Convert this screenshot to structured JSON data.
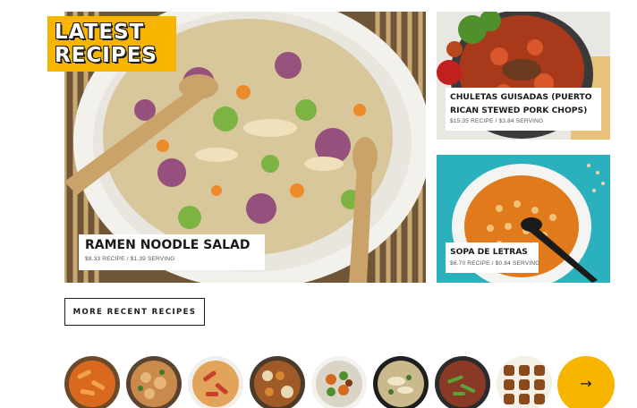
{
  "section": {
    "badge_line1": "LATEST",
    "badge_line2": "RECIPES",
    "badge_color": "#f7b500"
  },
  "featured": {
    "title": "RAMEN NOODLE SALAD",
    "cost": "$8.33 RECIPE / $1.39 SERVING"
  },
  "side_recipes": [
    {
      "title_line1": "CHULETAS GUISADAS (PUERTO",
      "title_line2": "RICAN STEWED PORK CHOPS)",
      "cost": "$15.35 RECIPE / $3.84 SERVING"
    },
    {
      "title": "SOPA DE LETRAS",
      "cost": "$6.70 RECIPE / $0.84 SERVING"
    }
  ],
  "more_button": {
    "label": "MORE RECENT RECIPES"
  },
  "carousel": {
    "thumbnails": [
      {
        "icon": "penne-pasta-thumbnail"
      },
      {
        "icon": "chicken-pasta-thumbnail"
      },
      {
        "icon": "tomato-penne-thumbnail"
      },
      {
        "icon": "curry-rice-thumbnail"
      },
      {
        "icon": "roasted-vegetables-thumbnail"
      },
      {
        "icon": "noodle-soup-thumbnail"
      },
      {
        "icon": "green-bean-noodles-thumbnail"
      },
      {
        "icon": "pretzel-bites-thumbnail"
      }
    ],
    "next_icon": "arrow-right-icon",
    "next_symbol": "→"
  }
}
